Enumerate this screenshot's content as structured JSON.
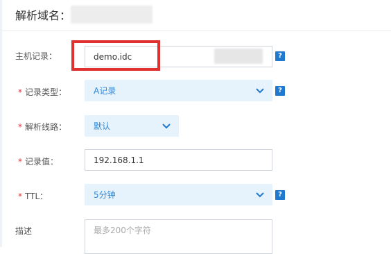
{
  "header": {
    "title": "解析域名："
  },
  "form": {
    "host": {
      "label": "主机记录：",
      "value": "demo.idc",
      "help": "?"
    },
    "record_type": {
      "required": "*",
      "label": "记录类型：",
      "value": "A记录",
      "help": "?"
    },
    "line": {
      "required": "*",
      "label": "解析线路：",
      "value": "默认"
    },
    "record_value": {
      "required": "*",
      "label": "记录值：",
      "value": "192.168.1.1"
    },
    "ttl": {
      "required": "*",
      "label": "TTL：",
      "value": "5分钟",
      "help": "?"
    },
    "description": {
      "label": "描述",
      "placeholder": "最多200个字符"
    }
  },
  "colors": {
    "accent": "#1e79cf",
    "select_text": "#2f86d6",
    "select_bg": "#e6f2fc",
    "required": "#e0353b",
    "highlight": "#e03030"
  },
  "icons": {
    "dropdown": "chevron-down-icon",
    "help": "question-mark-icon"
  }
}
